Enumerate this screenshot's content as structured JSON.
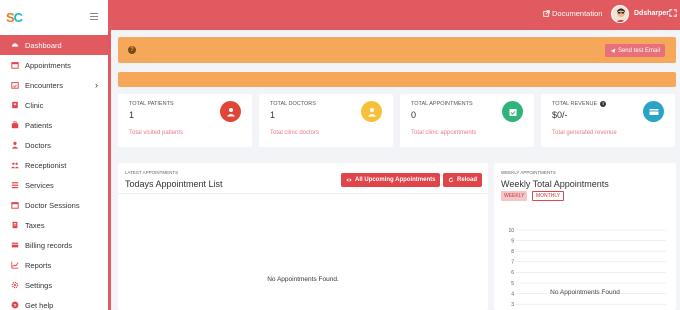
{
  "sidebar": {
    "logo_left": "S",
    "logo_right": "C",
    "items": [
      {
        "label": "Dashboard",
        "icon": "dashboard-icon",
        "active": true
      },
      {
        "label": "Appointments",
        "icon": "calendar-icon"
      },
      {
        "label": "Encounters",
        "icon": "calendar-check-icon",
        "has_children": true
      },
      {
        "label": "Clinic",
        "icon": "hospital-icon"
      },
      {
        "label": "Patients",
        "icon": "patients-icon"
      },
      {
        "label": "Doctors",
        "icon": "doctor-icon"
      },
      {
        "label": "Receptionist",
        "icon": "users-icon"
      },
      {
        "label": "Services",
        "icon": "list-icon"
      },
      {
        "label": "Doctor Sessions",
        "icon": "calendar-icon"
      },
      {
        "label": "Taxes",
        "icon": "tax-icon"
      },
      {
        "label": "Billing records",
        "icon": "billing-icon"
      },
      {
        "label": "Reports",
        "icon": "chart-icon"
      },
      {
        "label": "Settings",
        "icon": "gear-icon"
      },
      {
        "label": "Get help",
        "icon": "help-icon"
      }
    ]
  },
  "header": {
    "documentation_label": "Documentation",
    "user_name": "Ddsharper"
  },
  "alert": {
    "send_button_label": "Send test Email"
  },
  "stats": [
    {
      "label": "TOTAL PATIENTS",
      "value": "1",
      "sub": "Total visited patients",
      "color": "#e0453a"
    },
    {
      "label": "TOTAL DOCTORS",
      "value": "1",
      "sub": "Total clinic doctors",
      "color": "#f5c13b"
    },
    {
      "label": "TOTAL APPOINTMENTS",
      "value": "0",
      "sub": "Total clinic appointments",
      "color": "#2fb57a"
    },
    {
      "label": "TOTAL REVENUE",
      "value": "$0/-",
      "sub": "Total generated revenue",
      "color": "#2ba3c4"
    }
  ],
  "appointments": {
    "small_label": "LATEST APPOINTMENTS",
    "title": "Todays Appointment List",
    "upcoming_button": "All Upcoming Appointments",
    "reload_button": "Reload",
    "empty_message": "No Appointments Found."
  },
  "weekly": {
    "small_label": "WEEKLY APPOINTMENTS",
    "title": "Weekly Total Appointments",
    "tab_weekly": "WEEKLY",
    "tab_monthly": "MONTHLY",
    "empty_message": "No Appointments Found"
  },
  "chart_data": {
    "type": "line",
    "title": "Weekly Total Appointments",
    "y_ticks": [
      10,
      9,
      8,
      7,
      6,
      5,
      4,
      3
    ],
    "ylim": [
      0,
      10
    ],
    "series": []
  },
  "colors": {
    "primary": "#e05a5f",
    "warning": "#f6a85a"
  }
}
